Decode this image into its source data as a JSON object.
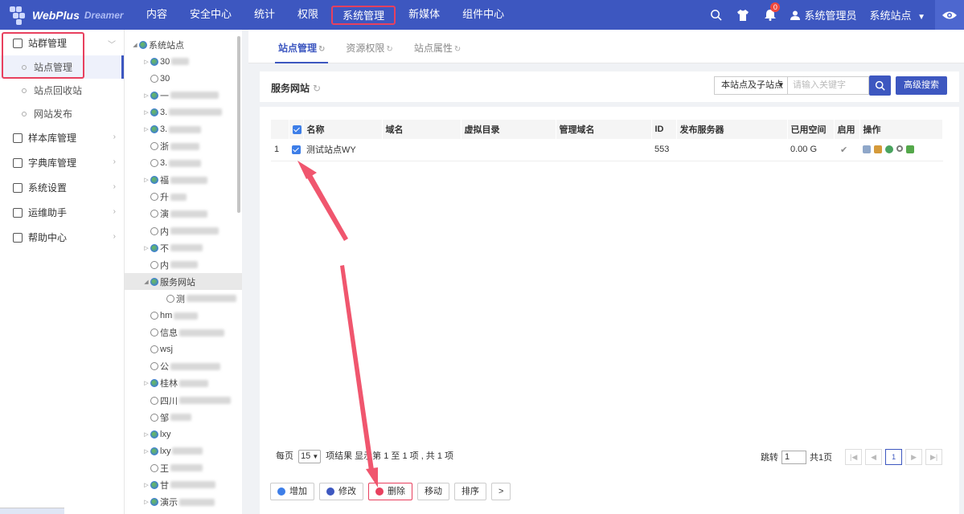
{
  "app": {
    "name": "WebPlus",
    "sub": "Dreamer"
  },
  "nav": [
    "内容",
    "安全中心",
    "统计",
    "权限",
    "系统管理",
    "新媒体",
    "组件中心"
  ],
  "nav_active": "系统管理",
  "top_right": {
    "notification_count": "0",
    "user": "系统管理员",
    "site_selector": "系统站点"
  },
  "sidebar": {
    "group_main": "站群管理",
    "subs": [
      "站点管理",
      "站点回收站",
      "网站发布"
    ],
    "groups": [
      "样本库管理",
      "字典库管理",
      "系统设置",
      "运维助手",
      "帮助中心"
    ]
  },
  "tree": {
    "root": "系统站点",
    "nodes": [
      "30",
      "30",
      "一",
      "3.",
      "3.",
      "浙",
      "3.",
      "福",
      "升",
      "演",
      "内",
      "不",
      "内",
      "服务网站",
      "测",
      "hm",
      "信息",
      "wsj",
      "公",
      "桂林",
      "四川",
      "邹",
      "lxy",
      "lxy",
      "王",
      "甘",
      "演示"
    ]
  },
  "tabs": [
    "站点管理",
    "资源权限",
    "站点属性"
  ],
  "toolbar": {
    "title": "服务网站",
    "scope": "本站点及子站点",
    "search_placeholder": "请输入关键字",
    "advanced": "高级搜索"
  },
  "table": {
    "headers": [
      "名称",
      "域名",
      "虚拟目录",
      "管理域名",
      "ID",
      "发布服务器",
      "已用空间",
      "启用",
      "操作"
    ],
    "rows": [
      {
        "idx": "1",
        "name": "测试站点WY",
        "domain": "",
        "vdir": "",
        "admin_domain": "",
        "id": "553",
        "server": "",
        "space": "0.00 G",
        "enabled": "✔"
      }
    ]
  },
  "pager": {
    "per_page_label": "每页",
    "per_page": "15",
    "summary": "项结果 显示第 1 至 1 项 , 共 1 项",
    "jump_label": "跳转",
    "jump_value": "1",
    "total_pages": "共1页",
    "current": "1"
  },
  "actions": {
    "add": "增加",
    "edit": "修改",
    "delete": "删除",
    "move": "移动",
    "sort": "排序",
    "more": ">"
  },
  "colors": {
    "brand": "#3d57c0",
    "highlight": "#e8405e",
    "arrow": "#f0566e"
  }
}
